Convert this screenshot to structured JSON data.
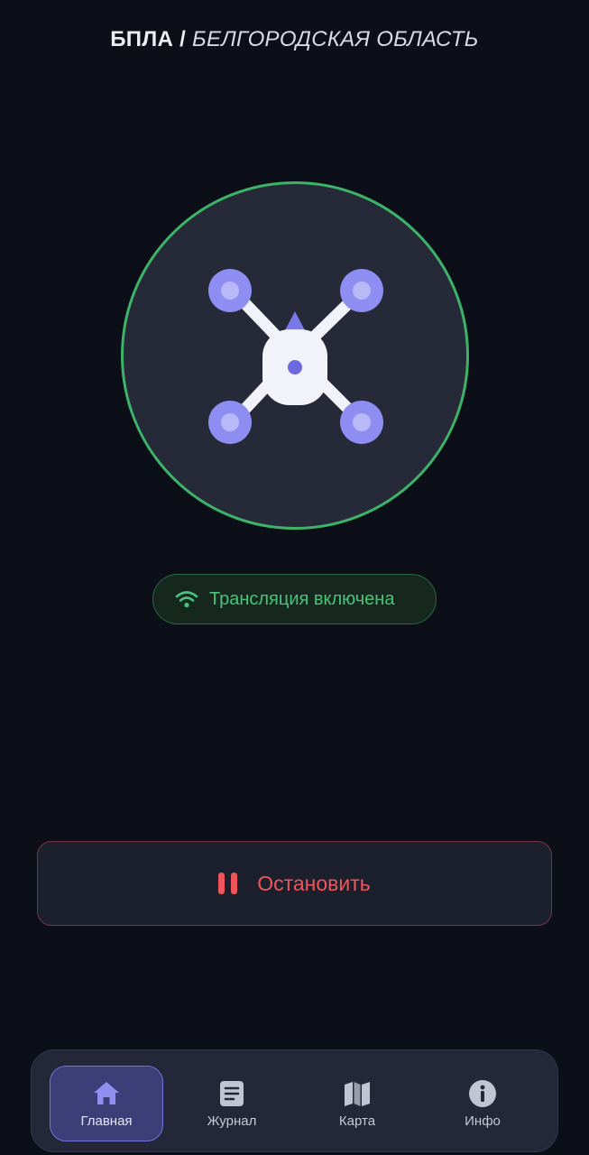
{
  "header": {
    "title_main": "БПЛА /",
    "title_region": " БЕЛГОРОДСКАЯ ОБЛАСТЬ"
  },
  "drone": {
    "icon": "quadcopter-drone-icon",
    "ring_color": "#3db36a"
  },
  "status": {
    "icon": "wifi-icon",
    "text": "Трансляция включена",
    "color": "#47c47a"
  },
  "stop_button": {
    "icon": "pause-icon",
    "label": "Остановить",
    "color": "#f0555b"
  },
  "nav": {
    "items": [
      {
        "label": "Главная",
        "icon": "home-icon",
        "active": true
      },
      {
        "label": "Журнал",
        "icon": "journal-icon",
        "active": false
      },
      {
        "label": "Карта",
        "icon": "map-icon",
        "active": false
      },
      {
        "label": "Инфо",
        "icon": "info-icon",
        "active": false
      }
    ]
  },
  "colors": {
    "background": "#0d0f18",
    "accent": "#6f73d8"
  }
}
